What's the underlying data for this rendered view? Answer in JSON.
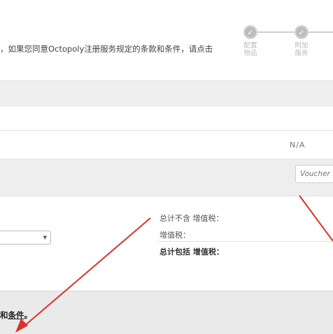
{
  "header": {
    "intro_text": "，如果您同意Octopoly注册服务规定的条款和条件，请点击",
    "steps": [
      {
        "label_line1": "配置",
        "label_line2": "物品"
      },
      {
        "label_line1": "附加",
        "label_line2": "服务"
      }
    ]
  },
  "summary": {
    "na_value": "N/A"
  },
  "voucher": {
    "placeholder": "Voucher"
  },
  "totals": {
    "subtotal_excl_vat_label": "总计不含 增值税：",
    "vat_label": "增值税：",
    "total_incl_vat_label": "总计包括 增值税："
  },
  "footer": {
    "terms_prefix": "和",
    "terms_link": "条件",
    "terms_suffix": "。"
  },
  "colors": {
    "annotation_arrow": "#e0302a",
    "step_inactive": "#bdbdbd",
    "band_grey": "#eeeeee"
  },
  "icons": {
    "step_check": "checkmark-icon"
  }
}
